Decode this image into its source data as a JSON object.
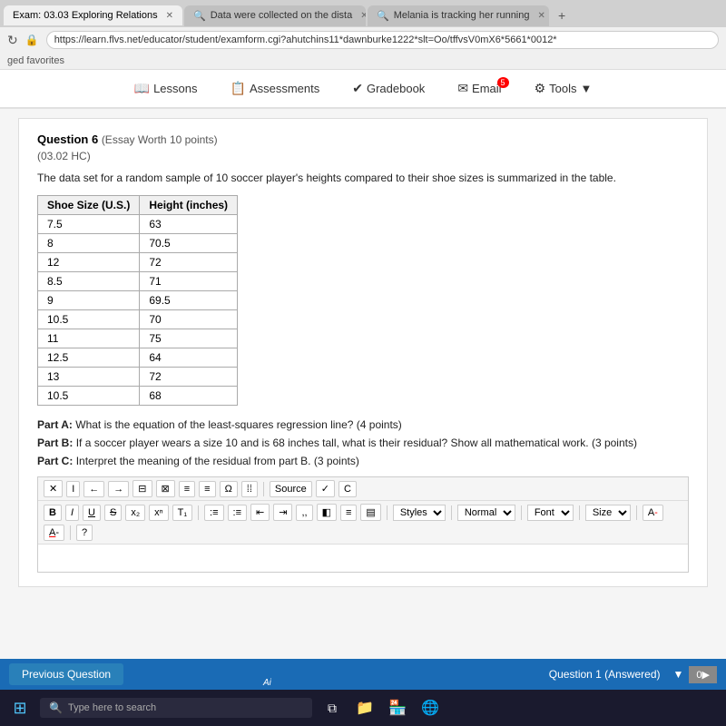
{
  "browser": {
    "tabs": [
      {
        "id": "tab1",
        "label": "Exam: 03.03 Exploring Relations",
        "active": true
      },
      {
        "id": "tab2",
        "label": "Data were collected on the dista",
        "active": false
      },
      {
        "id": "tab3",
        "label": "Melania is tracking her running",
        "active": false
      }
    ],
    "address": "https://learn.flvs.net/educator/student/examform.cgi?ahutchins11*dawnburke1222*slt=Oo/tffvsV0mX6*5661*0012*",
    "refresh_icon": "↻",
    "lock_icon": "🔒",
    "new_tab_icon": "+",
    "favorites_label": "ged favorites"
  },
  "nav": {
    "lessons_label": "Lessons",
    "assessments_label": "Assessments",
    "gradebook_label": "Gradebook",
    "email_label": "Email",
    "email_badge": "5",
    "tools_label": "Tools"
  },
  "question": {
    "number": "Question 6",
    "type_label": "(Essay Worth 10 points)",
    "code": "(03.02 HC)",
    "text": "The data set for a random sample of 10 soccer player's heights compared to their shoe sizes is summarized in the table.",
    "table": {
      "headers": [
        "Shoe Size (U.S.)",
        "Height (inches)"
      ],
      "rows": [
        [
          "7.5",
          "63"
        ],
        [
          "8",
          "70.5"
        ],
        [
          "12",
          "72"
        ],
        [
          "8.5",
          "71"
        ],
        [
          "9",
          "69.5"
        ],
        [
          "10.5",
          "70"
        ],
        [
          "11",
          "75"
        ],
        [
          "12.5",
          "64"
        ],
        [
          "13",
          "72"
        ],
        [
          "10.5",
          "68"
        ]
      ]
    },
    "parts": [
      {
        "id": "A",
        "label": "Part A:",
        "text": "What is the equation of the least-squares regression line? (4 points)"
      },
      {
        "id": "B",
        "label": "Part B:",
        "text": "If a soccer player wears a size 10 and is 68 inches tall, what is their residual? Show all mathematical work. (3 points)"
      },
      {
        "id": "C",
        "label": "Part C:",
        "text": "Interpret the meaning of the residual from part B. (3 points)"
      }
    ]
  },
  "toolbar": {
    "row1_buttons": [
      "✕",
      "I",
      "←",
      "→",
      "⊟",
      "⊠",
      "≡",
      "≡",
      "Ω",
      "⁞⁞",
      "Source",
      "✓",
      "C"
    ],
    "row2_buttons": [
      "B",
      "I",
      "U",
      "S",
      "x₂",
      "xⁿ",
      "T₁"
    ],
    "styles_label": "Styles",
    "normal_label": "Normal",
    "font_label": "Font",
    "size_label": "Size",
    "a_label": "A",
    "help_label": "?"
  },
  "bottom_bar": {
    "prev_button": "Previous Question",
    "status_text": "Question 1 (Answered)",
    "nav_icon": "0▶"
  },
  "taskbar": {
    "search_text": "Type here to search",
    "search_icon": "🔍",
    "windows_icon": "⊞",
    "files_icon": "📁",
    "apps_icon": "⊞",
    "browser_icon": "🌐",
    "ai_text": "Ai"
  }
}
